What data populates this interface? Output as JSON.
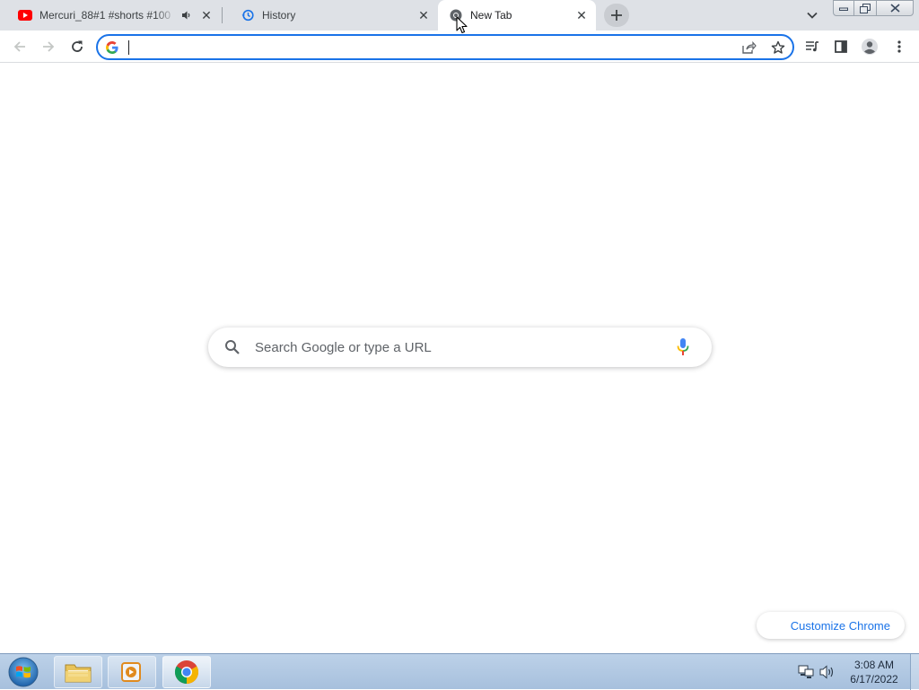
{
  "browser": {
    "tabs": [
      {
        "title": "Mercuri_88#1 #shorts #100",
        "favicon": "youtube-icon",
        "audio": "speaker-icon"
      },
      {
        "title": "History",
        "favicon": "history-icon"
      },
      {
        "title": "New Tab",
        "favicon": "chrome-icon"
      }
    ],
    "omnibox": {
      "value": ""
    }
  },
  "ntp": {
    "search_placeholder": "Search Google or type a URL",
    "customize_label": "Customize Chrome"
  },
  "taskbar": {
    "apps": [
      "windows-explorer-icon",
      "media-player-icon",
      "chrome-icon"
    ],
    "time": "3:08 AM",
    "date": "6/17/2022"
  },
  "colors": {
    "accent": "#1a73e8",
    "tabstrip": "#dee1e6",
    "taskbar": "#bcd1e8"
  }
}
